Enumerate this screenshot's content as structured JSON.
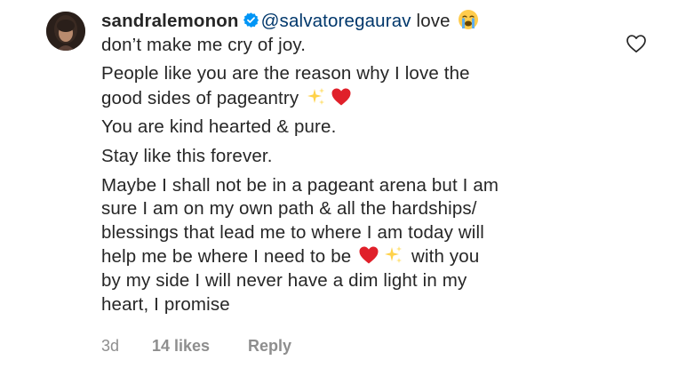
{
  "comment": {
    "username": "sandralemonon",
    "verified": true,
    "mention": "@salvatoregaurav",
    "lines": [
      " love",
      "don’t make me cry of joy.",
      "People like you are the reason why I love the",
      "good sides of pageantry",
      "You are kind hearted & pure.",
      "Stay like this forever.",
      "Maybe I shall not be in a pageant arena but I am",
      "sure I am on my own path & all the hardships/",
      "blessings that lead me to where I am today will",
      "help me be where I need to be",
      " with you",
      "by my side I will never have a dim light in my",
      "heart, I promise"
    ],
    "emojis": {
      "crying": "loudly-crying-face-icon",
      "sparkles": "sparkles-icon",
      "heart": "red-heart-icon"
    },
    "time": "3d",
    "likes": "14 likes",
    "reply_label": "Reply"
  },
  "colors": {
    "text": "#262626",
    "mention": "#00376b",
    "meta": "#8e8e8e",
    "verified": "#0095f6",
    "heart": "#e0202a"
  }
}
